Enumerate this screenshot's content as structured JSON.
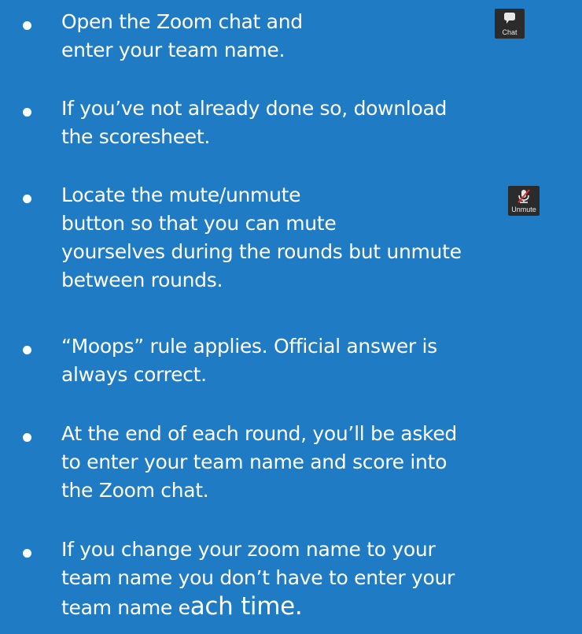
{
  "colors": {
    "background": "#1e7bc4",
    "text": "#ffffff",
    "icon_bg": "#2b2b2b",
    "mute_slash": "#e0302f"
  },
  "items": [
    {
      "lines": [
        "Open the Zoom chat and",
        "enter your team name."
      ]
    },
    {
      "lines": [
        "If you’ve not already done so, download",
        "the scoresheet."
      ]
    },
    {
      "lines": [
        "Locate the mute/unmute",
        "button so that you can mute",
        "yourselves during the rounds but unmute",
        "between rounds."
      ]
    },
    {
      "lines": [
        "“Moops” rule applies.  Official answer is",
        "always correct."
      ]
    },
    {
      "lines": [
        "At the end of each round, you’ll be asked",
        "to enter your team name and score into",
        "the Zoom chat."
      ]
    },
    {
      "lines": [
        "If you change your zoom name to your",
        "team name you don’t have to enter your"
      ],
      "last_line_start": "team name e",
      "last_line_end": "ach time."
    }
  ],
  "icons": {
    "chat": {
      "name": "chat-icon",
      "label": "Chat"
    },
    "unmute": {
      "name": "microphone-muted-icon",
      "label": "Unmute"
    }
  }
}
